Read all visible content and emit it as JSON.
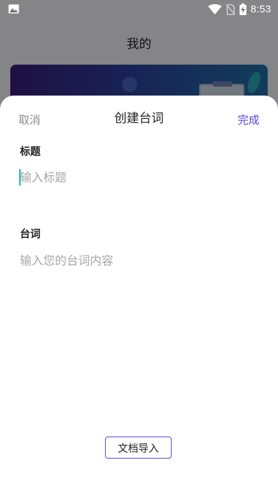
{
  "status_bar": {
    "time": "8:53",
    "icons": [
      "image-icon",
      "wifi-icon",
      "no-sim-icon",
      "battery-charging-icon"
    ]
  },
  "background_page": {
    "title": "我的"
  },
  "sheet": {
    "cancel_label": "取消",
    "title": "创建台词",
    "done_label": "完成",
    "title_section": {
      "label": "标题",
      "placeholder": "输入标题",
      "value": ""
    },
    "lines_section": {
      "label": "台词",
      "placeholder": "输入您的台词内容",
      "value": ""
    },
    "import_button_label": "文档导入"
  },
  "colors": {
    "accent": "#4f46e5",
    "caret": "#1bb3a4",
    "placeholder": "#a6a6a6"
  }
}
